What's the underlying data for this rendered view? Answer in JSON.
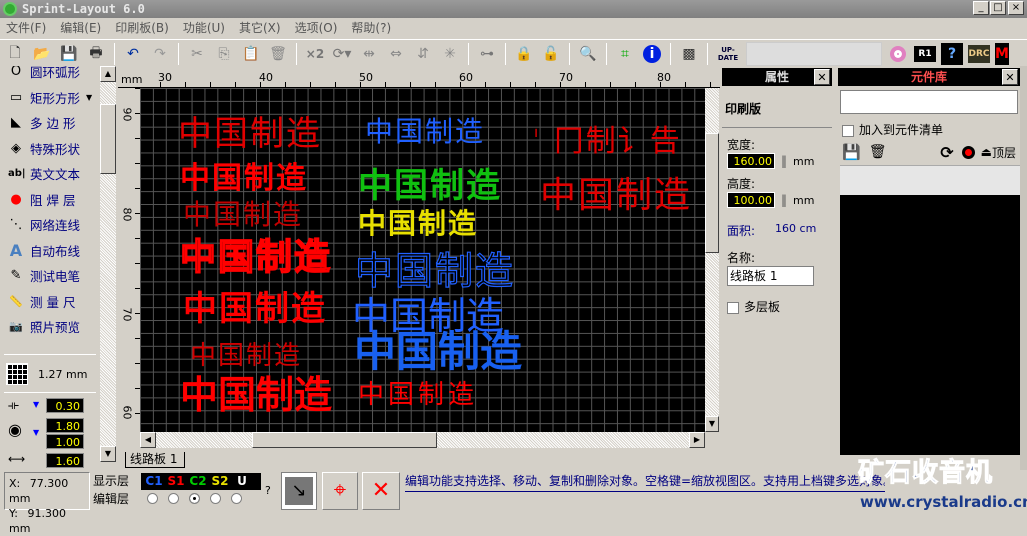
{
  "window": {
    "title": "Sprint-Layout 6.0",
    "min": "_",
    "max": "□",
    "close": "×"
  },
  "menu": [
    "文件(F)",
    "编辑(E)",
    "印刷板(B)",
    "功能(U)",
    "其它(X)",
    "选项(O)",
    "帮助(?)"
  ],
  "toolbar": {
    "x2": "×2",
    "update": "UP-DATE",
    "r1": "R1",
    "drc": "DRC",
    "m": "M"
  },
  "tools": [
    {
      "label": "圆环弧形",
      "icon": "O"
    },
    {
      "label": "矩形方形",
      "icon": "▭"
    },
    {
      "label": "多 边 形",
      "icon": "◣"
    },
    {
      "label": "特殊形状",
      "icon": "◈"
    },
    {
      "label": "英文文本",
      "icon": "ab|"
    },
    {
      "label": "阻 焊 层",
      "icon": "●"
    },
    {
      "label": "网络连线",
      "icon": "⋱"
    },
    {
      "label": "自动布线",
      "icon": "A"
    },
    {
      "label": "测试电笔",
      "icon": "✎"
    },
    {
      "label": "测 量 尺",
      "icon": "📏"
    },
    {
      "label": "照片预览",
      "icon": "📷"
    }
  ],
  "grid": {
    "value": "1.27 mm"
  },
  "track": {
    "width": "0.30"
  },
  "pad": {
    "outer": "1.80",
    "inner": "1.00",
    "next": "1.60"
  },
  "ruler": {
    "unit": "mm",
    "h": [
      "30",
      "40",
      "50",
      "60",
      "70",
      "80"
    ],
    "v": [
      "90",
      "80",
      "70",
      "60"
    ]
  },
  "canvas_texts": [
    {
      "text": "中国制造",
      "color": "#e00000"
    },
    {
      "text": "中国制造",
      "color": "#ff0000"
    },
    {
      "text": "中国制造",
      "color": "#c00000"
    },
    {
      "text": "中国制造",
      "color": "#ff0000"
    },
    {
      "text": "中国制造",
      "color": "#ff0000"
    },
    {
      "text": "中国制造",
      "color": "#d00000"
    },
    {
      "text": "中国制造",
      "color": "#ff0000"
    },
    {
      "text": "中国制造",
      "color": "#2060ff"
    },
    {
      "text": "中国制造",
      "color": "#10c010"
    },
    {
      "text": "中国制造",
      "color": "#e8e000"
    },
    {
      "text": "中国制造",
      "color": "#2060ff"
    },
    {
      "text": "中国制造",
      "color": "#2060ff"
    },
    {
      "text": "中国制造",
      "color": "#1860f0"
    },
    {
      "text": "中国制造",
      "color": "#ff0000"
    },
    {
      "text": "' 冂制讠告",
      "color": "#e00000"
    },
    {
      "text": "中国制造",
      "color": "#e00000"
    }
  ],
  "tab": "线路板 1",
  "properties": {
    "title": "属性",
    "section": "印刷版",
    "width_label": "宽度:",
    "width": "160.00",
    "height_label": "高度:",
    "height": "100.00",
    "unit": "mm",
    "area_label": "面积:",
    "area": "160 cm",
    "name_label": "名称:",
    "name": "线路板 1",
    "multilayer": "多层板"
  },
  "library": {
    "title": "元件库",
    "add_to_list": "加入到元件清单",
    "layer": "顶层"
  },
  "status": {
    "x_label": "X:",
    "x": "77.300 mm",
    "y_label": "Y:",
    "y": "91.300 mm",
    "show_layer": "显示层",
    "edit_layer": "编辑层",
    "layers": [
      "C1",
      "S1",
      "C2",
      "S2",
      "U"
    ],
    "help": "?"
  },
  "hint": "编辑功能支持选择、移动、复制和删除对象。空格键=缩放视图区。支持用上档键多选对象。",
  "watermark": {
    "title": "矿石收音机",
    "url": "www.crystalradio.cn"
  },
  "colors": {
    "C1": "#2060ff",
    "S1": "#ff0000",
    "C2": "#00c000",
    "S2": "#e8e000",
    "U": "#ffffff"
  }
}
